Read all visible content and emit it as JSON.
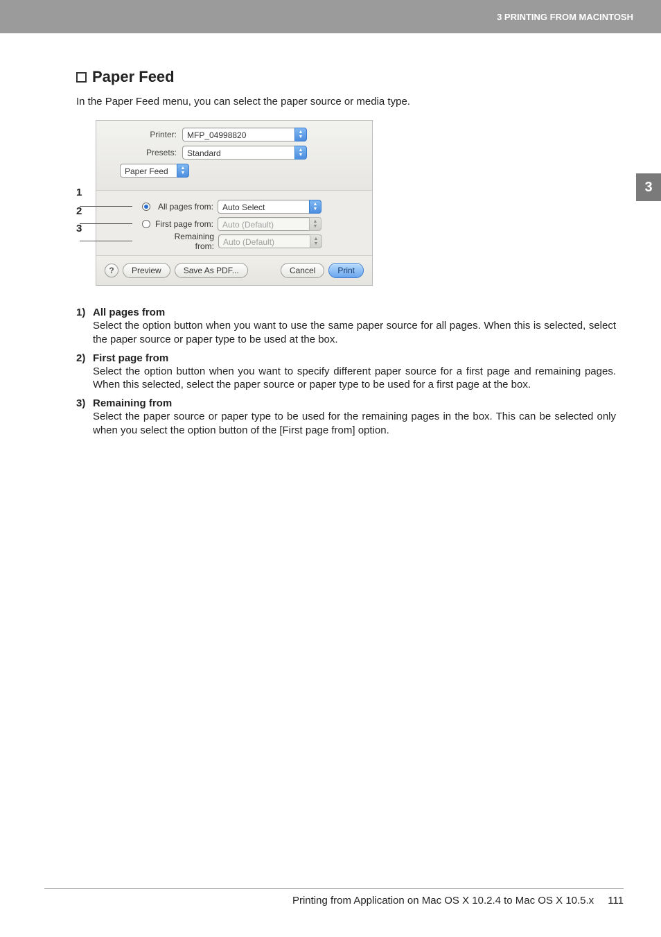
{
  "header": {
    "chapter_label": "3 PRINTING FROM MACINTOSH",
    "side_tab": "3"
  },
  "page": {
    "heading": "Paper Feed",
    "intro": "In the Paper Feed menu, you can select the paper source or media type."
  },
  "dialog": {
    "printer_label": "Printer:",
    "printer_value": "MFP_04998820",
    "presets_label": "Presets:",
    "presets_value": "Standard",
    "pane_value": "Paper Feed",
    "row1": {
      "label": "All pages from:",
      "value": "Auto Select"
    },
    "row2": {
      "label": "First page from:",
      "value": "Auto (Default)"
    },
    "row3": {
      "label": "Remaining from:",
      "value": "Auto (Default)"
    },
    "buttons": {
      "help": "?",
      "preview": "Preview",
      "save_pdf": "Save As PDF...",
      "cancel": "Cancel",
      "print": "Print"
    }
  },
  "callouts": {
    "n1": "1",
    "n2": "2",
    "n3": "3"
  },
  "descriptions": [
    {
      "num": "1)",
      "title": "All pages from",
      "text": "Select the option button when you want to use the same paper source for all pages.  When this is selected, select the paper source or paper type to be used at the box."
    },
    {
      "num": "2)",
      "title": "First page from",
      "text": "Select the option button when you want to specify different paper source for a first page and remaining pages.  When this selected, select the paper source or paper type to be used for a first page at the box."
    },
    {
      "num": "3)",
      "title": "Remaining from",
      "text": "Select the paper source or paper type to be used for the remaining pages in the box.  This can be selected only when you select the option button of the [First page from] option."
    }
  ],
  "footer": {
    "text": "Printing from Application on Mac OS X 10.2.4 to Mac OS X 10.5.x",
    "page": "111"
  }
}
